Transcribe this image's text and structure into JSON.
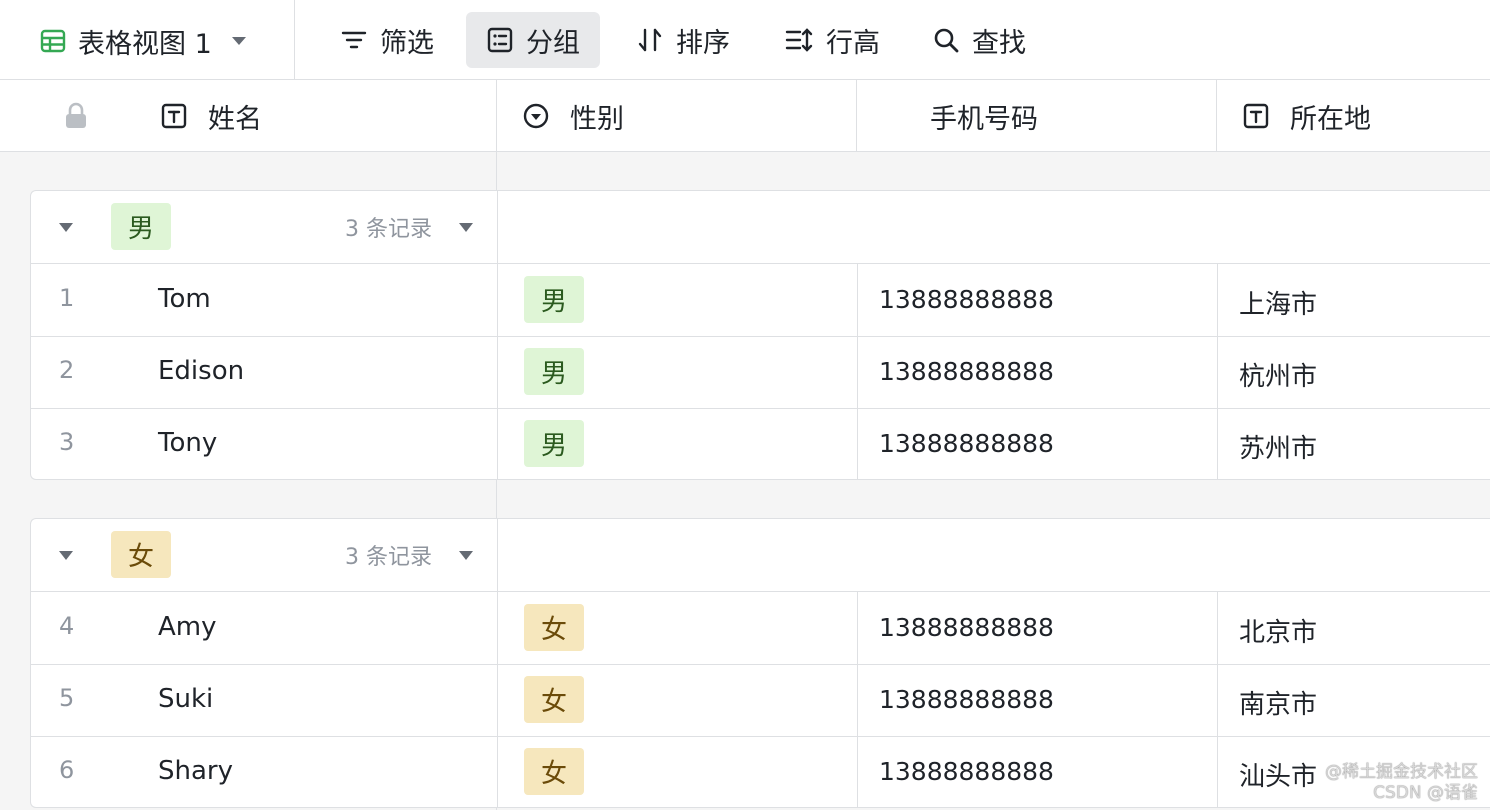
{
  "toolbar": {
    "view_name": "表格视图 1",
    "filter_label": "筛选",
    "group_label": "分组",
    "sort_label": "排序",
    "row_height_label": "行高",
    "find_label": "查找"
  },
  "columns": {
    "name": "姓名",
    "gender": "性别",
    "phone": "手机号码",
    "location": "所在地"
  },
  "groups": [
    {
      "tag": "男",
      "count_label": "3 条记录",
      "rows": [
        {
          "num": "1",
          "name": "Tom",
          "gender": "男",
          "phone": "13888888888",
          "city": "上海市"
        },
        {
          "num": "2",
          "name": "Edison",
          "gender": "男",
          "phone": "13888888888",
          "city": "杭州市"
        },
        {
          "num": "3",
          "name": "Tony",
          "gender": "男",
          "phone": "13888888888",
          "city": "苏州市"
        }
      ]
    },
    {
      "tag": "女",
      "count_label": "3 条记录",
      "rows": [
        {
          "num": "4",
          "name": "Amy",
          "gender": "女",
          "phone": "13888888888",
          "city": "北京市"
        },
        {
          "num": "5",
          "name": "Suki",
          "gender": "女",
          "phone": "13888888888",
          "city": "南京市"
        },
        {
          "num": "6",
          "name": "Shary",
          "gender": "女",
          "phone": "13888888888",
          "city": "汕头市"
        }
      ]
    }
  ],
  "watermark": {
    "line1": "@稀土掘金技术社区",
    "line2": "CSDN @语雀"
  },
  "colors": {
    "male_tag_bg": "#dff5d6",
    "female_tag_bg": "#f6e7bd",
    "accent_green": "#34a853"
  }
}
